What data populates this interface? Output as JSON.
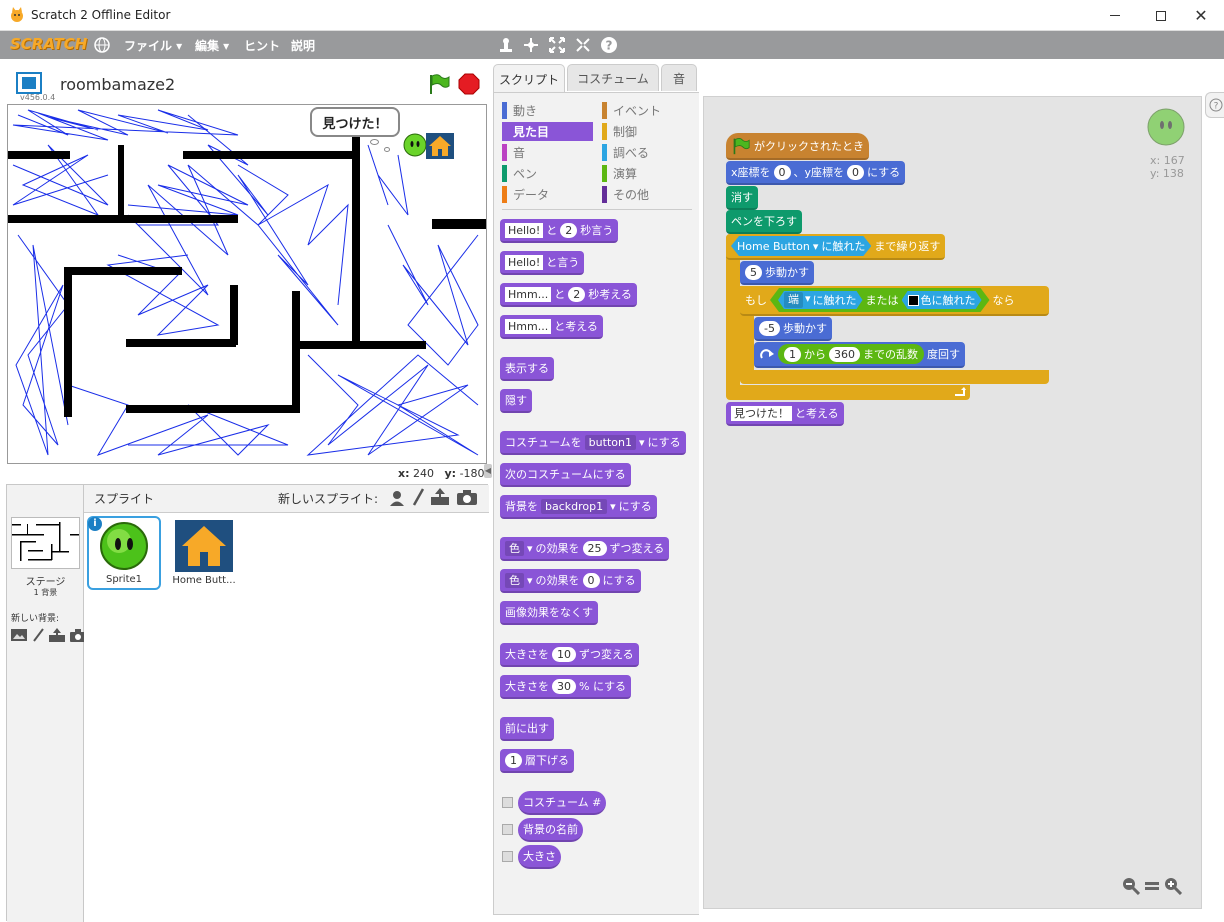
{
  "window": {
    "title": "Scratch 2 Offline Editor"
  },
  "menubar": {
    "logo": "SCRATCH",
    "file": "ファイル ▾",
    "edit": "編集 ▾",
    "tips": "ヒント",
    "about": "説明"
  },
  "stage": {
    "project_name": "roombamaze2",
    "version": "v456.0.4",
    "speech": "見つけた！",
    "coord_x_label": "x:",
    "coord_x": "240",
    "coord_y_label": "y:",
    "coord_y": "-180"
  },
  "sprites": {
    "header": "スプライト",
    "new_sprite": "新しいスプライト:",
    "stage_label": "ステージ",
    "backdrop_count": "1 背景",
    "new_backdrop": "新しい背景:",
    "items": [
      {
        "name": "Sprite1"
      },
      {
        "name": "Home Butt..."
      }
    ]
  },
  "tabs": [
    {
      "label": "スクリプト"
    },
    {
      "label": "コスチューム"
    },
    {
      "label": "音"
    }
  ],
  "categories": {
    "left": [
      {
        "label": "動き",
        "color": "#4a6cd4"
      },
      {
        "label": "見た目",
        "color": "#8a55d7"
      },
      {
        "label": "音",
        "color": "#bb42c3"
      },
      {
        "label": "ペン",
        "color": "#0e9a6c"
      },
      {
        "label": "データ",
        "color": "#ee7d16"
      }
    ],
    "right": [
      {
        "label": "イベント",
        "color": "#c88330"
      },
      {
        "label": "制御",
        "color": "#e1a91a"
      },
      {
        "label": "調べる",
        "color": "#2ca5e2"
      },
      {
        "label": "演算",
        "color": "#5cb712"
      },
      {
        "label": "その他",
        "color": "#632d99"
      }
    ]
  },
  "palette": {
    "say_secs": {
      "a": "Hello!",
      "b": "と",
      "n": "2",
      "c": "秒言う"
    },
    "say": {
      "a": "Hello!",
      "b": "と言う"
    },
    "think_secs": {
      "a": "Hmm...",
      "b": "と",
      "n": "2",
      "c": "秒考える"
    },
    "think": {
      "a": "Hmm...",
      "b": "と考える"
    },
    "show": "表示する",
    "hide": "隠す",
    "switch_costume": {
      "a": "コスチュームを",
      "d": "button1",
      "b": "にする"
    },
    "next_costume": "次のコスチュームにする",
    "switch_backdrop": {
      "a": "背景を",
      "d": "backdrop1",
      "b": "にする"
    },
    "change_effect": {
      "d": "色",
      "a": "の効果を",
      "n": "25",
      "b": "ずつ変える"
    },
    "set_effect": {
      "d": "色",
      "a": "の効果を",
      "n": "0",
      "b": "にする"
    },
    "clear_effects": "画像効果をなくす",
    "change_size": {
      "a": "大きさを",
      "n": "10",
      "b": "ずつ変える"
    },
    "set_size": {
      "a": "大きさを",
      "n": "30",
      "b": "% にする"
    },
    "front": "前に出す",
    "back": {
      "n": "1",
      "a": "層下げる"
    },
    "rep_costume": "コスチューム #",
    "rep_backdrop": "背景の名前",
    "rep_size": "大きさ"
  },
  "script": {
    "hat": "がクリックされたとき",
    "goto": {
      "a": "x座標を",
      "x": "0",
      "b": "、y座標を",
      "y": "0",
      "c": "にする"
    },
    "clear": "消す",
    "pendown": "ペンを下ろす",
    "repeat_until": {
      "d": "Home Button",
      "a": "に触れた",
      "b": "まで繰り返す"
    },
    "move1": {
      "n": "5",
      "a": "歩動かす"
    },
    "if": {
      "a": "もし",
      "d": "端",
      "b": "に触れた",
      "or": "または",
      "c": "色に触れた",
      "then": "なら"
    },
    "move2": {
      "n": "-5",
      "a": "歩動かす"
    },
    "turn": {
      "n1": "1",
      "a": "から",
      "n2": "360",
      "b": "までの乱数",
      "c": "度回す"
    },
    "think": {
      "s": "見つけた！",
      "a": "と考える"
    },
    "sprite_x": "x: 167",
    "sprite_y": "y: 138"
  }
}
